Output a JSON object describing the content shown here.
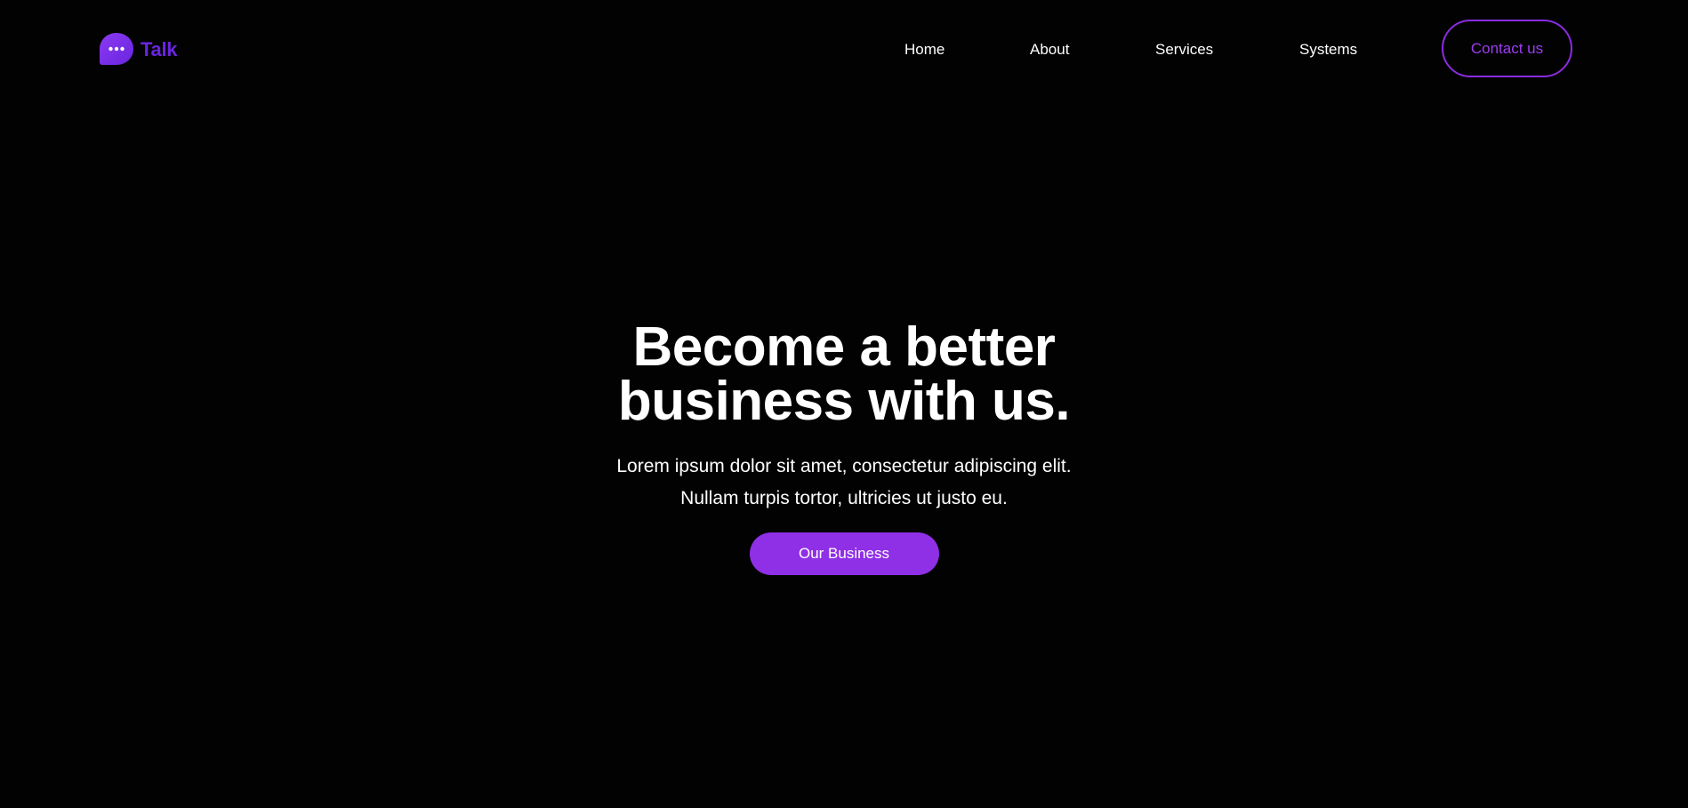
{
  "brand": {
    "name": "Talk",
    "icon": "chat-bubble-icon",
    "color": "#6a25e0"
  },
  "nav": {
    "links": [
      {
        "label": "Home"
      },
      {
        "label": "About"
      },
      {
        "label": "Services"
      },
      {
        "label": "Systems"
      }
    ],
    "contact_label": "Contact us"
  },
  "hero": {
    "title_line1": "Become a better",
    "title_line2": "business with us.",
    "subtitle_line1": "Lorem ipsum dolor sit amet, consectetur adipiscing elit.",
    "subtitle_line2": "Nullam turpis tortor, ultricies ut justo eu.",
    "cta_label": "Our Business"
  },
  "colors": {
    "background": "#020202",
    "accent": "#8f2fe6",
    "contact_text": "#9b3df0",
    "contact_border": "#8a2ce0",
    "text": "#ffffff"
  }
}
